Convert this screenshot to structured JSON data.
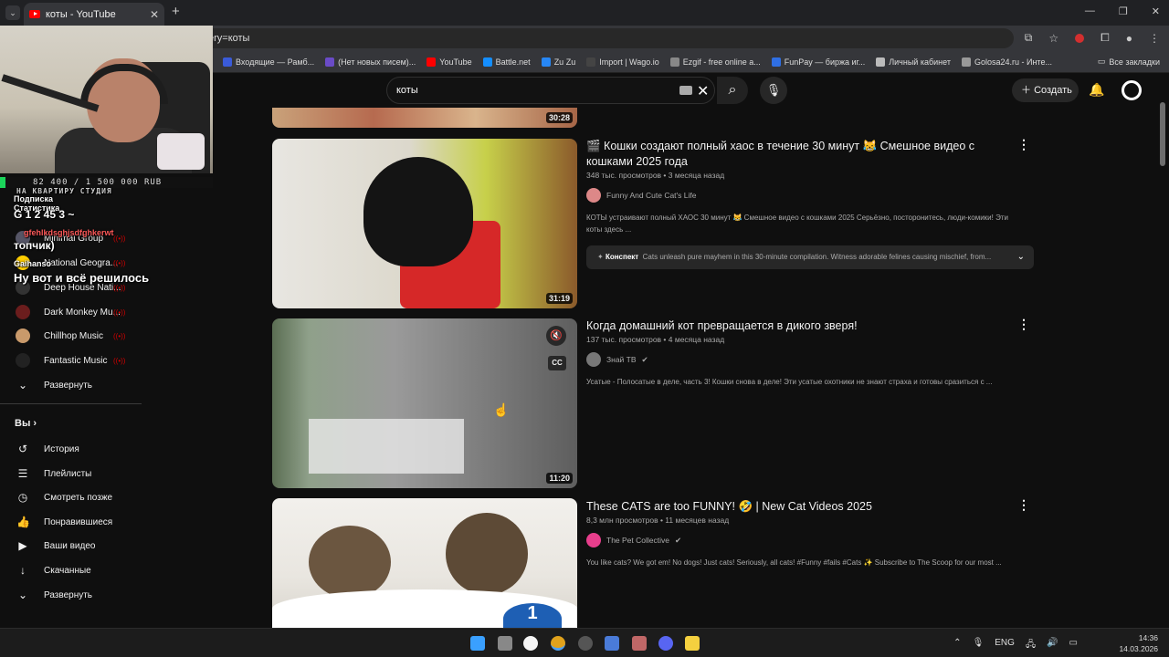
{
  "browser": {
    "tab_title": "коты - YouTube",
    "url_fragment": "ery=коты",
    "bookmarks": [
      {
        "label": "Входящие — Рамб...",
        "color": "#3a5bd9"
      },
      {
        "label": "(Нет новых писем)...",
        "color": "#6a4bc7"
      },
      {
        "label": "YouTube",
        "color": "#ff0000"
      },
      {
        "label": "Battle.net",
        "color": "#148eff"
      },
      {
        "label": "Zu Zu",
        "color": "#2787f5"
      },
      {
        "label": "Import | Wago.io",
        "color": "#444444"
      },
      {
        "label": "Ezgif - free online a...",
        "color": "#888888"
      },
      {
        "label": "FunPay — биржа иг...",
        "color": "#2f6fe4"
      },
      {
        "label": "Личный кабинет",
        "color": "#bbbbbb"
      },
      {
        "label": "Golosa24.ru - Инте...",
        "color": "#999999"
      }
    ],
    "all_bookmarks": "Все закладки"
  },
  "header": {
    "search_value": "коты",
    "create_label": "Создать"
  },
  "sidebar": {
    "subscriptions": [
      {
        "label": "Minimal Group",
        "color": "#556"
      },
      {
        "label": "National Geogra...",
        "color": "#ffce00"
      },
      {
        "label": "Deep House Nati...",
        "color": "#333"
      },
      {
        "label": "Dark Monkey Mu...",
        "color": "#6b1d1d"
      },
      {
        "label": "Chillhop Music",
        "color": "#c99a6b"
      },
      {
        "label": "Fantastic Music",
        "color": "#222"
      }
    ],
    "expand_label": "Развернуть",
    "you_label": "Вы",
    "you_items": [
      {
        "label": "История",
        "icon": "history-icon",
        "glyph": "↺"
      },
      {
        "label": "Плейлисты",
        "icon": "playlists-icon",
        "glyph": "☰"
      },
      {
        "label": "Смотреть позже",
        "icon": "watch-later-icon",
        "glyph": "◷"
      },
      {
        "label": "Понравившиеся",
        "icon": "like-icon",
        "glyph": "👍"
      },
      {
        "label": "Ваши видео",
        "icon": "your-videos-icon",
        "glyph": "▶"
      },
      {
        "label": "Скачанные",
        "icon": "download-icon",
        "glyph": "↓"
      }
    ],
    "expand_label_2": "Развернуть"
  },
  "stream_overlay": {
    "goal": "82 400 / 1 500 000 RUB",
    "goal_sub": "НА КВАРТИРУ СТУДИЯ",
    "stats_title_a": "Подписка",
    "stats_title_b": "Статистика",
    "stats_row": "G 1  2  45  3  ~",
    "user1": "gfehlkdsghjsdfghkerwt",
    "topchik": "топчик)",
    "user2": "Gaihanso",
    "message": "Ну вот и всё решилось"
  },
  "videos": [
    {
      "duration": "30:28"
    },
    {
      "title": "🎬 Кошки создают полный хаос в течение 30 минут 😹 Смешное видео с кошками 2025 года",
      "meta": "348 тыс. просмотров • 3 месяца назад",
      "channel": "Funny And Cute Cat's Life",
      "channel_color": "#d88",
      "description": "КОТЫ устраивают полный ХАОС 30 минут 😹 Смешное видео с кошками 2025 Серьёзно, посторонитесь, люди-комики! Эти коты здесь ...",
      "konspekt_label": "Конспект",
      "konspekt_text": "Cats unleash pure mayhem in this 30-minute compilation. Witness adorable felines causing mischief, from...",
      "duration": "31:19"
    },
    {
      "title": "Когда домашний кот превращается в дикого зверя!",
      "meta": "137 тыс. просмотров • 4 месяца назад",
      "channel": "Знай ТВ",
      "channel_color": "#777",
      "description": "Усатые - Полосатые в деле, часть 3! Кошки снова в деле! Эти усатые охотники не знают страха и готовы сразиться с ...",
      "duration": "11:20"
    },
    {
      "title": "These CATS are too FUNNY! 🤣 | New Cat Videos 2025",
      "meta": "8,3 млн просмотров • 11 месяцев назад",
      "channel": "The Pet Collective",
      "channel_color": "#e83e8c",
      "description": "You like cats? We got em! No dogs! Just cats! Seriously, all cats! #Funny #fails #Cats ✨ Subscribe to The Scoop for our most ..."
    }
  ],
  "taskbar": {
    "lang": "ENG",
    "time": "14:36",
    "date": "14.03.2026"
  }
}
